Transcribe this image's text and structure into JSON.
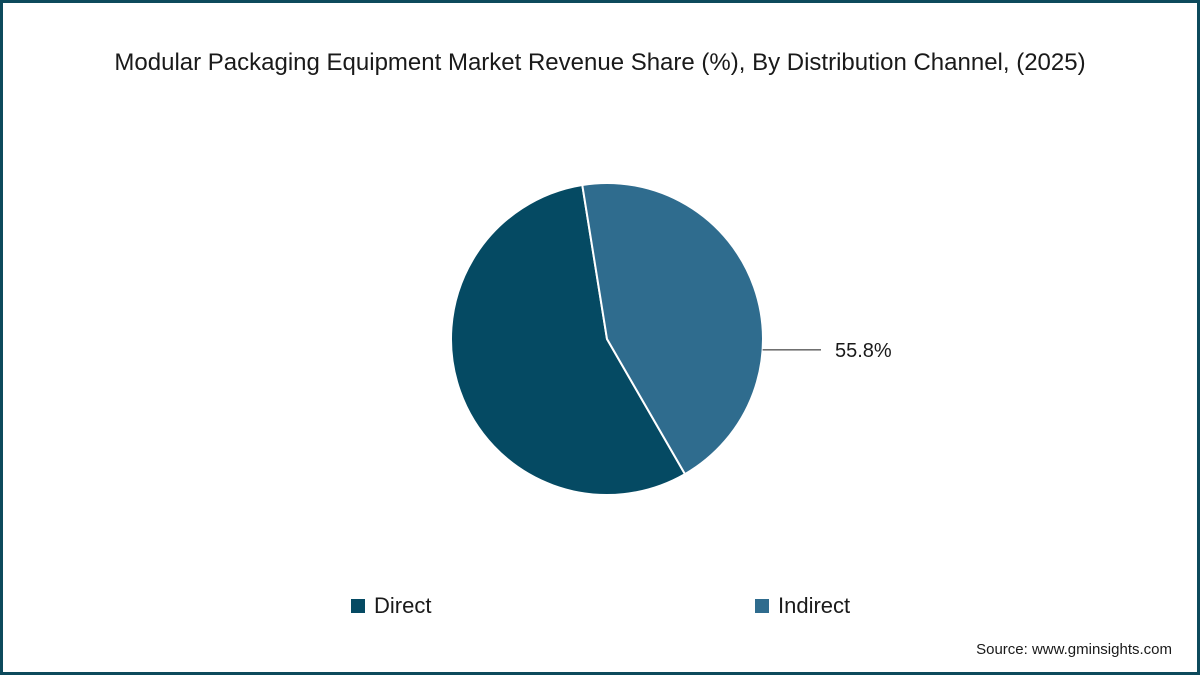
{
  "chart_data": {
    "type": "pie",
    "title": "Modular Packaging Equipment Market Revenue Share (%), By Distribution Channel, (2025)",
    "categories": [
      "Direct",
      "Indirect"
    ],
    "values": [
      55.8,
      44.2
    ],
    "colors": [
      "#054a63",
      "#2f6c8e"
    ],
    "data_labels": [
      "55.8%"
    ],
    "legend_position": "bottom"
  },
  "legend": {
    "items": [
      {
        "label": "Direct",
        "color": "#054a63"
      },
      {
        "label": "Indirect",
        "color": "#2f6c8e"
      }
    ]
  },
  "source": "Source: www.gminsights.com",
  "colors": {
    "border": "#0d4a5c",
    "text": "#1a1a1a"
  }
}
